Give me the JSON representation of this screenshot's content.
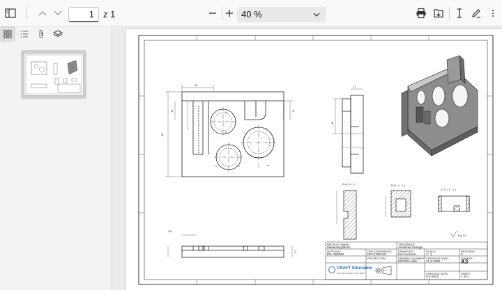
{
  "toolbar": {
    "page_current": "1",
    "page_total": "z 1",
    "zoom": "40 %",
    "icons": [
      "sidebar-toggle-icon",
      "chevron-up-icon",
      "chevron-down-icon",
      "minus-icon",
      "plus-icon",
      "chevron-down-icon",
      "print-icon",
      "save-icon",
      "text-cursor-icon",
      "draw-icon",
      "more-icon"
    ]
  },
  "sidebar": {
    "tools": [
      "thumbnails-icon",
      "outline-icon",
      "attachments-icon",
      "layers-icon"
    ]
  },
  "drawing": {
    "section_aa": "A-A ( 1 : 1 )",
    "section_bb": "B-B ( 1 : 1 )",
    "section_cc": "C-C ( 1 : 1 )",
    "roughness": "Ra 1,6",
    "title_block": {
      "productname_label": "PRODUCTNAME:",
      "productname": "Measuring Block",
      "treatment_label": "TREATMENT:",
      "treatment": "Anodized Orange",
      "material_label": "MATERIAL:",
      "material": "EN AW6082",
      "tolerance_label": "GEN TOLERANCE:",
      "tolerance": "ISO 2768-mK",
      "drawnby_label": "DRAWN BY:",
      "drawnby": "tom svensen",
      "scale_label": "SCALE:",
      "scale": "1 : 1",
      "revision_label": "REVISION:",
      "revision": "0",
      "projection_label": "PROJECTION:",
      "drawingnumber_label": "DRAWING NUMBER:",
      "drawingnumber": "MST001.sldw",
      "creationdate_label": "CREATION DATE:",
      "creationdate": "21-8-2016",
      "format_label": "FORMAT:",
      "format": "A3",
      "checkeddate_label": "CHECKED DATE:",
      "checkeddate": "6-3-2021",
      "sheet_label": "SHEET:",
      "sheet": "1 of 1",
      "company": "CRAFT Education",
      "company_tagline": "next generation education"
    }
  }
}
